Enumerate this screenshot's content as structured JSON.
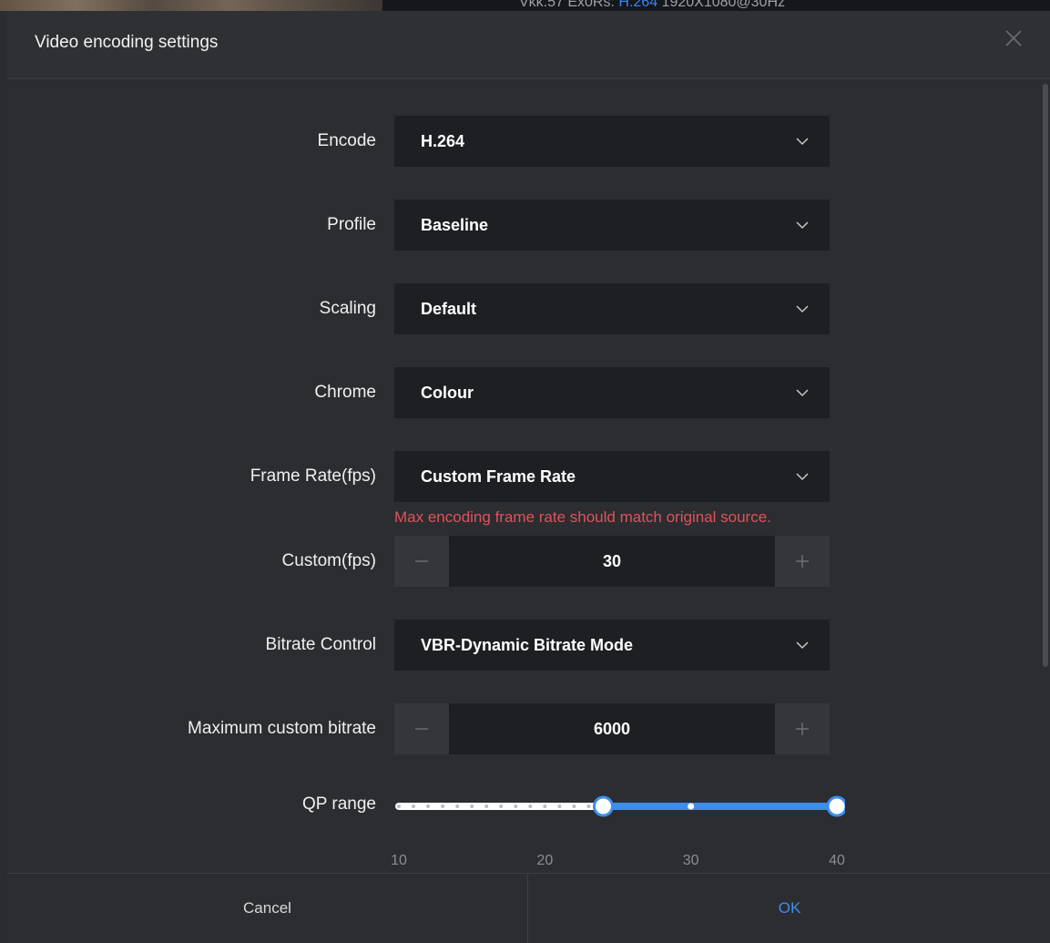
{
  "background": {
    "text_prefix": "Vkk.57 Ex0Rs:",
    "text_link": "H.264",
    "text_suffix": "1920X1080@30Hz"
  },
  "dialog": {
    "title": "Video encoding settings",
    "close_icon": "close-icon"
  },
  "fields": {
    "encode": {
      "label": "Encode",
      "value": "H.264"
    },
    "profile": {
      "label": "Profile",
      "value": "Baseline"
    },
    "scaling": {
      "label": "Scaling",
      "value": "Default"
    },
    "chrome": {
      "label": "Chrome",
      "value": "Colour"
    },
    "frame_rate": {
      "label": "Frame Rate(fps)",
      "value": "Custom Frame Rate",
      "warning": "Max encoding frame rate should match original source."
    },
    "custom_fps": {
      "label": "Custom(fps)",
      "value": "30"
    },
    "bitrate_control": {
      "label": "Bitrate Control",
      "value": "VBR-Dynamic Bitrate Mode"
    },
    "max_bitrate": {
      "label": "Maximum custom bitrate",
      "value": "6000"
    }
  },
  "qp_range": {
    "label": "QP range",
    "min": 10,
    "max": 40,
    "low": 24,
    "high": 40,
    "ticks": [
      "10",
      "20",
      "30",
      "40"
    ],
    "accent_color": "#3d8eea"
  },
  "footer": {
    "cancel_label": "Cancel",
    "ok_label": "OK"
  }
}
